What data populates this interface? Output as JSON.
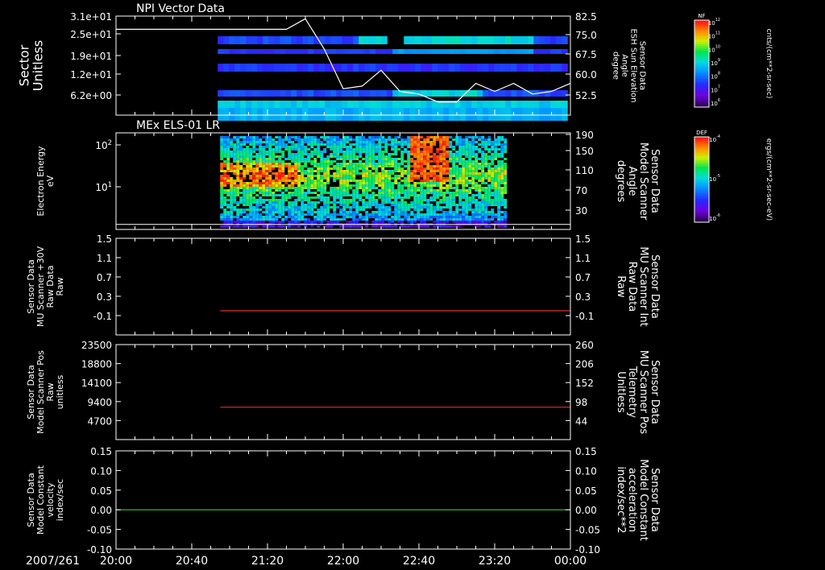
{
  "colors": {
    "white": "#ffffff",
    "red": "#e03030",
    "green": "#2ecc40"
  },
  "chart_data": [
    {
      "type": "heatmap",
      "title": "NPI Vector Data",
      "ylabel_left": [
        "Sector",
        "Unitless"
      ],
      "ylabel_right": [
        "Sensor Data",
        "ESH Sun Elevation",
        "Angle",
        "degree"
      ],
      "yticks_left": [
        "3.1e+01",
        "2.5e+01",
        "1.9e+01",
        "1.2e+01",
        "6.2e+00"
      ],
      "yticks_right": [
        "82.5",
        "75.0",
        "67.5",
        "60.0",
        "52.5"
      ],
      "ylim_right": [
        45,
        82.5
      ],
      "colorbar": {
        "label": "NF",
        "unit": "cnts/(cm**2-sr-sec)",
        "ticks": [
          "10^12",
          "10^11",
          "10^10",
          "10^9",
          "10^8",
          "10^7",
          "10^6"
        ]
      },
      "line_series": {
        "x": [
          "20:00",
          "20:30",
          "21:00",
          "21:20",
          "21:30",
          "21:40",
          "21:50",
          "22:00",
          "22:10",
          "22:20",
          "22:30",
          "22:40",
          "22:50",
          "23:00",
          "23:10",
          "23:20",
          "23:30",
          "23:40",
          "23:50",
          "00:00"
        ],
        "y": [
          77.5,
          77.5,
          77.5,
          77.5,
          77.5,
          81.5,
          70,
          55,
          56,
          62,
          54,
          53,
          50,
          50,
          57,
          54,
          57,
          53,
          54,
          57
        ]
      }
    },
    {
      "type": "heatmap",
      "title": "MEx ELS-01 LR",
      "ylabel_left": [
        "Electron Energy",
        "eV"
      ],
      "ylabel_right": [
        "Sensor Data",
        "Model Scanner",
        "Angle",
        "degrees"
      ],
      "yticks_left": [
        "10^2",
        "10^1"
      ],
      "yticks_right": [
        "190",
        "150",
        "110",
        "70",
        "30"
      ],
      "ylim_right": [
        0,
        190
      ],
      "colorbar": {
        "label": "DEF",
        "unit": "ergs/(cm**2-sr-sec-eV)",
        "ticks": [
          "10^-4",
          "10^-5",
          "10^-6"
        ]
      },
      "line_series": {
        "x": [
          "20:00",
          "00:00"
        ],
        "y": [
          10,
          10
        ]
      }
    },
    {
      "type": "line",
      "ylabel_left": [
        "Sensor Data",
        "MU Scanner +30V",
        "Raw Data",
        "Raw"
      ],
      "ylabel_right": [
        "Sensor Data",
        "MU Scanner Int",
        "Raw Data",
        "Raw"
      ],
      "yticks_left": [
        "1.5",
        "1.1",
        "0.7",
        "0.3",
        "-0.1"
      ],
      "yticks_right": [
        "1.5",
        "1.1",
        "0.7",
        "0.3",
        "-0.1"
      ],
      "ylim": [
        -0.5,
        1.5
      ],
      "series": [
        {
          "x": [
            "20:55",
            "00:00"
          ],
          "y": [
            -0.0,
            -0.0
          ]
        }
      ]
    },
    {
      "type": "line",
      "ylabel_left": [
        "Sensor Data",
        "Model Scanner Pos",
        "Raw",
        "unitless"
      ],
      "ylabel_right": [
        "Sensor Data",
        "MU Scanner Pos",
        "Telemetry",
        "Unitless"
      ],
      "yticks_left": [
        "23500",
        "18800",
        "14100",
        "9400",
        "4700"
      ],
      "yticks_right": [
        "260",
        "206",
        "152",
        "98",
        "44"
      ],
      "ylim": [
        0,
        23500
      ],
      "series": [
        {
          "x": [
            "20:55",
            "00:00"
          ],
          "y": [
            8000,
            8000
          ]
        }
      ]
    },
    {
      "type": "line",
      "ylabel_left": [
        "Sensor Data",
        "Model Constant",
        "velocity",
        "index/sec"
      ],
      "ylabel_right": [
        "Sensor Data",
        "Model Constant",
        "acceleration",
        "index/sec**2"
      ],
      "yticks_left": [
        "0.15",
        "0.10",
        "0.05",
        "0.00",
        "-0.05",
        "-0.10"
      ],
      "yticks_right": [
        "0.15",
        "0.10",
        "0.05",
        "0.00",
        "-0.05",
        "-0.10"
      ],
      "ylim": [
        -0.1,
        0.15
      ],
      "series": [
        {
          "x": [
            "20:00",
            "00:00"
          ],
          "y": [
            0.0,
            0.0
          ]
        }
      ]
    }
  ],
  "xaxis": {
    "date_label": "2007/261",
    "ticks": [
      "20:00",
      "20:40",
      "21:20",
      "22:00",
      "22:40",
      "23:20",
      "00:00"
    ]
  }
}
